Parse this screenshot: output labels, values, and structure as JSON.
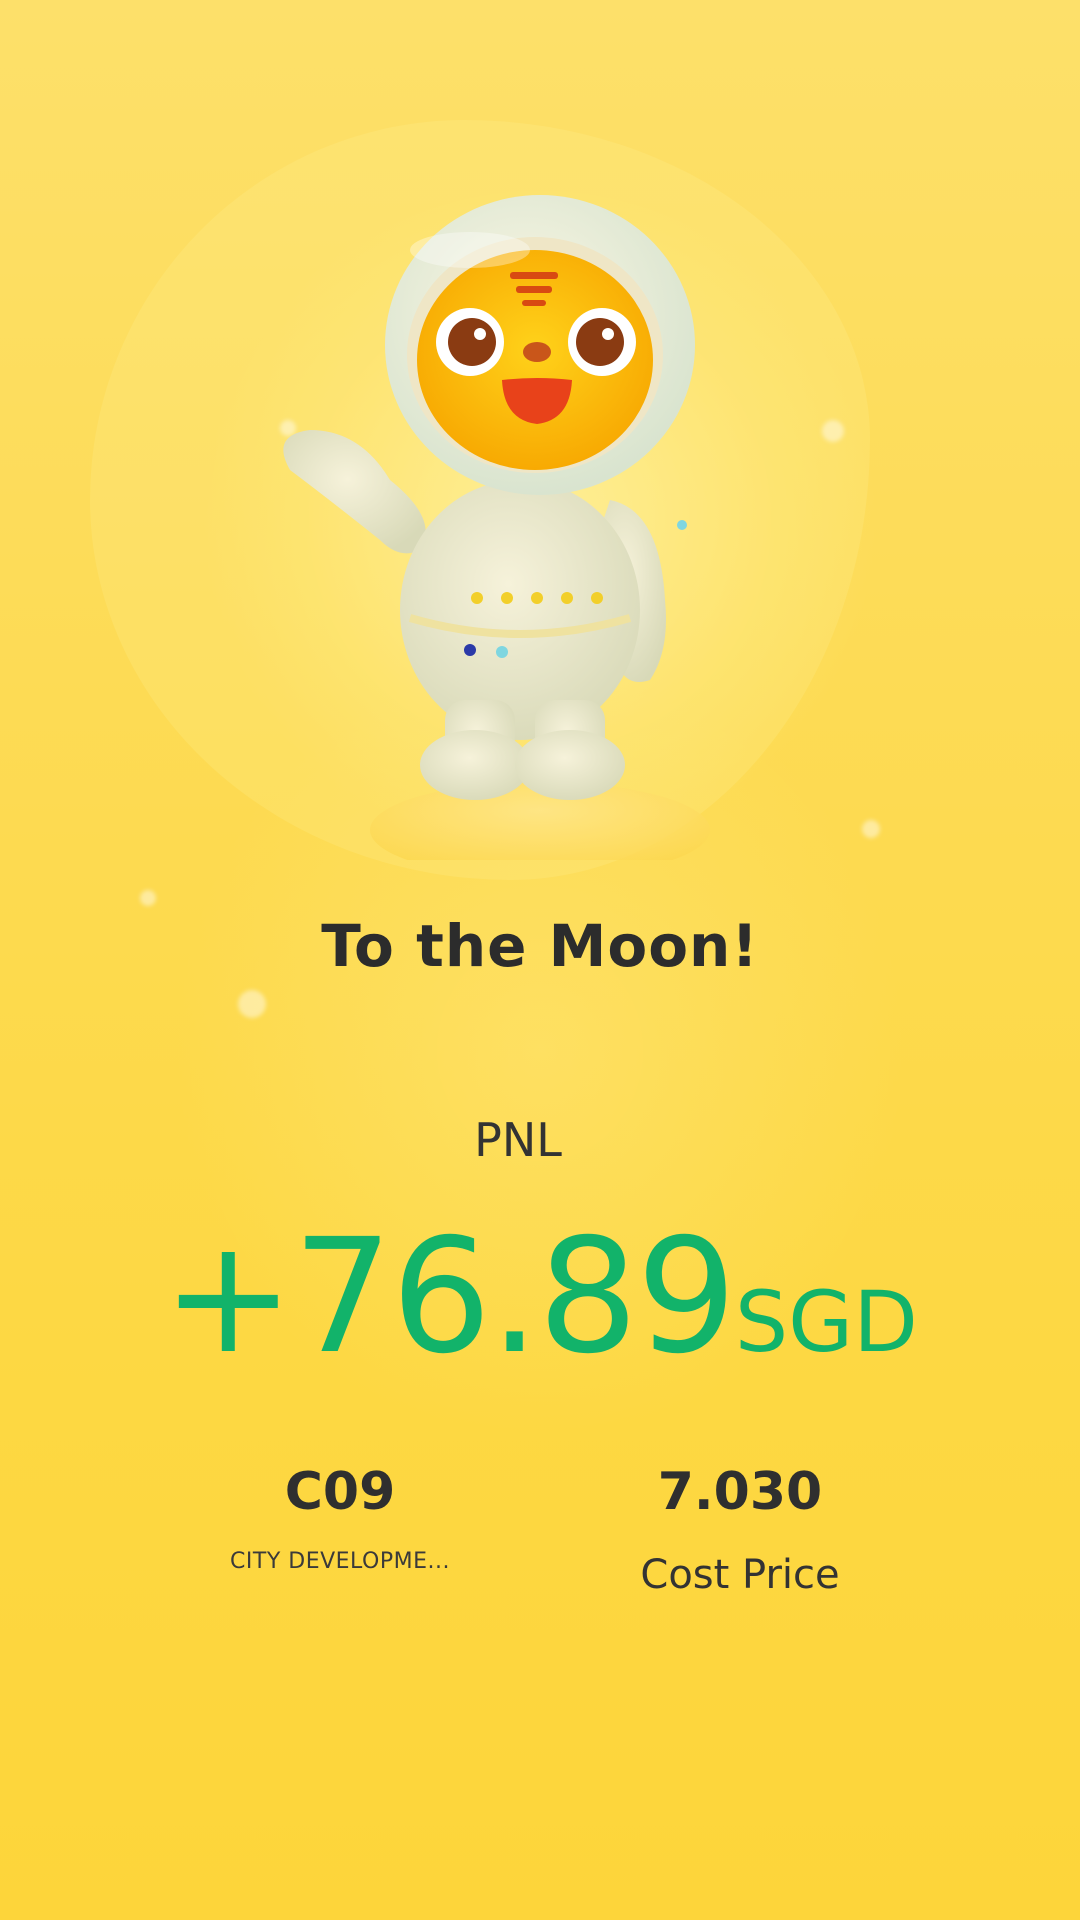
{
  "card": {
    "title": "To the Moon!",
    "pnl_label": "PNL",
    "pnl_amount": "+76.89",
    "pnl_currency": "SGD",
    "symbol": "C09",
    "company_name": "CITY DEVELOPME...",
    "cost_price": "7.030",
    "cost_price_label": "Cost Price"
  },
  "illustration": {
    "name": "astronaut-tiger-mascot",
    "icon": "tiger-astronaut-illustration"
  },
  "colors": {
    "background": "#fdd63c",
    "positive": "#12b36a",
    "text_dark": "#2c2c2c"
  }
}
